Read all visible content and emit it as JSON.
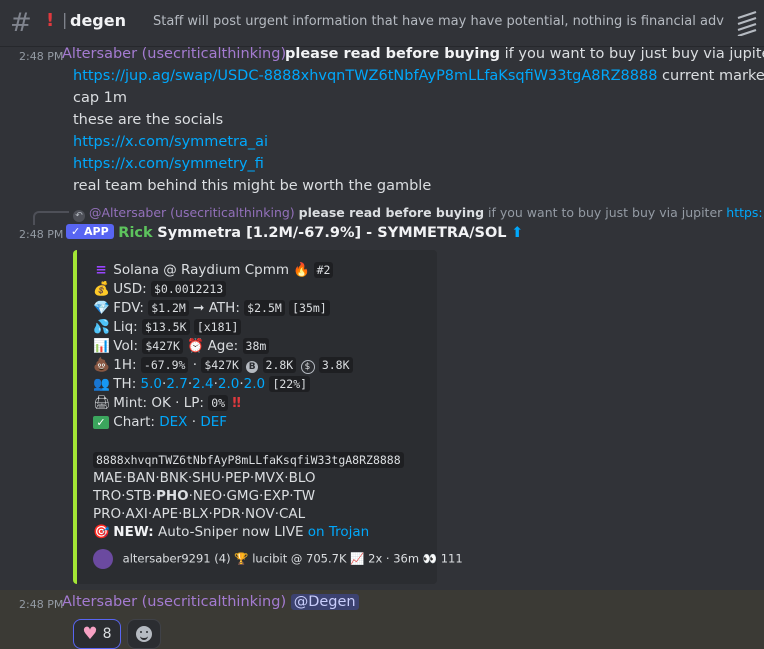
{
  "header": {
    "channel_name": "degen",
    "alert_glyph": "!",
    "topic": "Staff will post urgent information that have may have potential, nothing is financial advice. Yo..."
  },
  "msg1": {
    "time": "2:48 PM",
    "author": "Altersaber (usecriticalthinking)",
    "bold": "please read before buying",
    "text1": " if you want to buy just buy via jupiter",
    "link1": "https://jup.ag/swap/USDC-8888xhvqnTWZ6tNbfAyP8mLLfaKsqfiW33tgA8RZ8888",
    "text2": " current market",
    "text3": "cap 1m",
    "text4": "these are the socials",
    "link2": "https://x.com/symmetra_ai",
    "link3": "https://x.com/symmetry_fi",
    "text5": "real team behind this might be worth the gamble"
  },
  "reply": {
    "author": "@Altersaber (usecriticalthinking)",
    "bold": "please read before buying",
    "text": " if you want to buy just buy via jupiter ",
    "link": "https://ju..."
  },
  "msg2": {
    "time": "2:48 PM",
    "badge": "✓ APP",
    "author": "Rick",
    "title": "Symmetra [1.2M/-67.9%] - SYMMETRA/SOL",
    "arrow": "⬆"
  },
  "embed": {
    "pair": "Solana @ Raydium Cpmm",
    "rank": "#2",
    "usd_label": "USD:",
    "usd": "$0.0012213",
    "fdv_label": "FDV:",
    "fdv": "$1.2M",
    "ath_label": "ATH:",
    "ath": "$2.5M",
    "ath_age": "[35m]",
    "liq_label": "Liq:",
    "liq": "$13.5K",
    "liq_x": "[x181]",
    "vol_label": "Vol:",
    "vol": "$427K",
    "age_label": "Age:",
    "age": "38m",
    "h1_label": "1H:",
    "h1_change": "-67.9%",
    "h1_vol": "$427K",
    "h1_buys": "2.8K",
    "h1_sells": "3.8K",
    "th_label": "TH:",
    "th_values": [
      "5.0",
      "2.7",
      "2.4",
      "2.0",
      "2.0"
    ],
    "th_total": "[22%]",
    "mint_label": "Mint: OK · LP:",
    "lp": "0%",
    "chart_label": "Chart:",
    "chart_links": [
      "DEX",
      "DEF"
    ],
    "address": "8888xhvqnTWZ6tNbfAyP8mLLfaKsqfiW33tgA8RZ8888",
    "links_row1": [
      "MAE",
      "BAN",
      "BNK",
      "SHU",
      "PEP",
      "MVX",
      "BLO"
    ],
    "links_row2": [
      "TRO",
      "STB",
      "PHO",
      "NEO",
      "GMG",
      "EXP",
      "TW"
    ],
    "links_row3": [
      "PRO",
      "AXI",
      "APE",
      "BLX",
      "PDR",
      "NOV",
      "CAL"
    ],
    "new_label": "NEW:",
    "new_text": " Auto-Sniper now LIVE ",
    "new_link": "on Trojan",
    "footer_user": "altersaber9291 (4)",
    "footer_trophy": "lucibit @ 705.7K",
    "footer_stats": "2x · 36m",
    "footer_views": "111"
  },
  "msg3": {
    "time": "2:48 PM",
    "author": "Altersaber (usecriticalthinking)",
    "mention": "@Degen"
  },
  "reactions": {
    "heart_count": "8"
  }
}
